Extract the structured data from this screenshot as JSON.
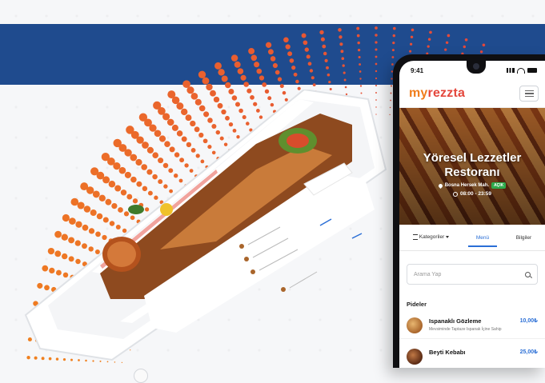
{
  "phone": {
    "status_time": "9:41",
    "logo_part1": "my",
    "logo_part2": "rezzta",
    "hero_title": "Yöresel Lezzetler Restoranı",
    "location": "Bosna Hersek Mah.",
    "open_badge": "AÇIK",
    "hours": "08:00 - 23:59",
    "tabs": [
      "Kategoriler",
      "Menü",
      "Bilgiler"
    ],
    "search_placeholder": "Arama Yap",
    "section_title": "Pideler",
    "items": [
      {
        "name": "Ispanaklı Gözleme",
        "desc": "Mevsiminde Taptaze Ispanak İçine Sahip",
        "price": "10,00₺"
      },
      {
        "name": "Beyti Kebabı",
        "desc": "",
        "price": "25,00₺"
      }
    ]
  },
  "colors": {
    "brand_orange": "#f07d1b",
    "brand_red": "#e4473c",
    "band_blue": "#1f4b8e",
    "accent_blue": "#2b6fd6",
    "open_green": "#2eaa4c"
  }
}
